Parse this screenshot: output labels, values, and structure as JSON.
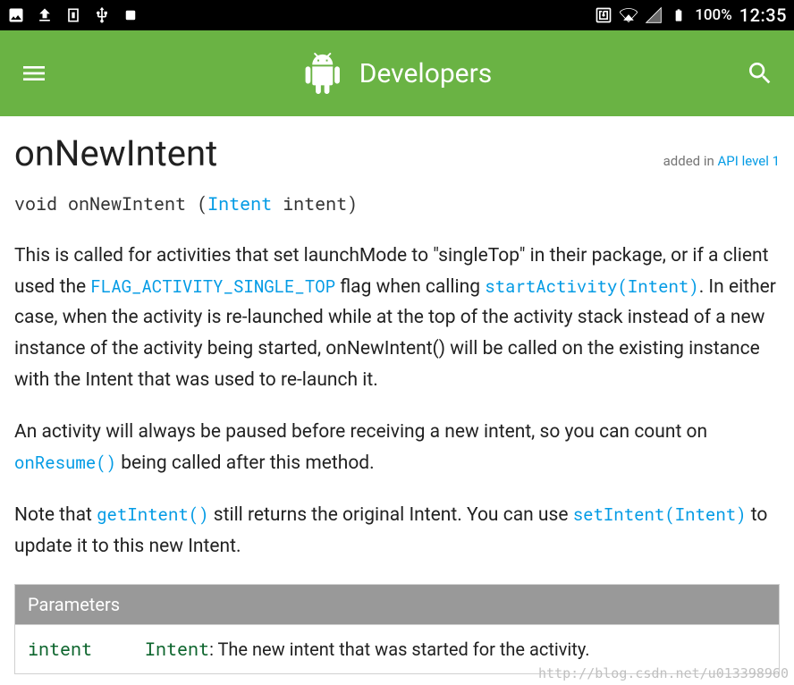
{
  "status_bar": {
    "battery_text": "100%",
    "time": "12:35"
  },
  "app_bar": {
    "title": "Developers"
  },
  "page": {
    "title": "onNewIntent",
    "added_in_prefix": "added in ",
    "api_level_label": "API level 1"
  },
  "signature": {
    "return_type": "void",
    "method": "onNewIntent",
    "param_type": "Intent",
    "param_name": "intent"
  },
  "para1": {
    "t1": "This is called for activities that set launchMode to \"singleTop\" in their package, or if a client used the ",
    "link1": "FLAG_ACTIVITY_SINGLE_TOP",
    "t2": " flag when calling ",
    "link2": "startActivity(Intent)",
    "t3": ". In either case, when the activity is re-launched while at the top of the activity stack instead of a new instance of the activity being started, onNewIntent() will be called on the existing instance with the Intent that was used to re-launch it."
  },
  "para2": {
    "t1": "An activity will always be paused before receiving a new intent, so you can count on ",
    "link1": "onResume()",
    "t2": " being called after this method."
  },
  "para3": {
    "t1": "Note that ",
    "link1": "getIntent()",
    "t2": " still returns the original Intent. You can use ",
    "link2": "setIntent(Intent)",
    "t3": " to update it to this new Intent."
  },
  "params_table": {
    "header": "Parameters",
    "rows": [
      {
        "name": "intent",
        "type": "Intent",
        "desc": ": The new intent that was started for the activity."
      }
    ]
  },
  "watermark": "http://blog.csdn.net/u013398960"
}
